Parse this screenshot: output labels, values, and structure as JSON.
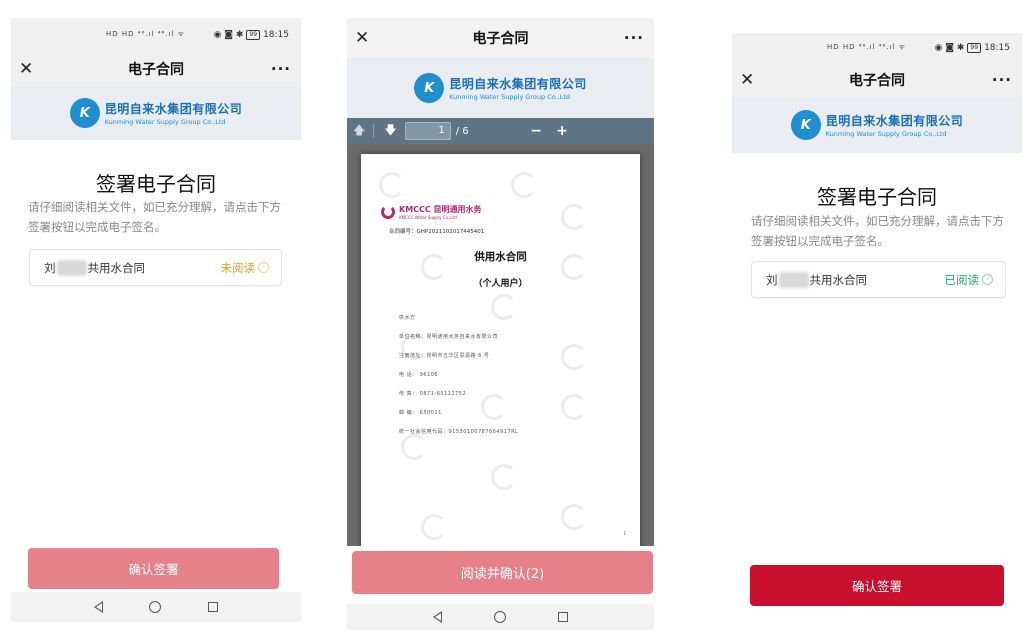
{
  "screen1": {
    "status_left": "HD HD ⁴⁶.ıl ⁴⁶.ıl ᯤ",
    "status_right": "◉ ◙ ✱",
    "battery": "99",
    "time": "18:15",
    "nav_close": "✕",
    "nav_title": "电子合同",
    "nav_more": "···",
    "logo_cn": "昆明自来水集团有限公司",
    "logo_en": "Kunming Water Supply Group Co.,Ltd",
    "sign_title": "签署电子合同",
    "sign_desc": "请仔细阅读相关文件，如已充分理解，请点击下方签署按钮以完成电子签名。",
    "contract_prefix": "刘",
    "contract_suffix": "共用水合同",
    "contract_status": "未阅读",
    "confirm_label": "确认签署"
  },
  "screen2": {
    "nav_close": "✕",
    "nav_title": "电子合同",
    "nav_more": "···",
    "logo_cn": "昆明自来水集团有限公司",
    "logo_en": "Kunming Water Supply Group Co.,Ltd",
    "toolbar": {
      "up_icon": "🡅",
      "down_icon": "🡇",
      "page": "1",
      "total": "/ 6",
      "minus": "−",
      "plus": "+"
    },
    "pdf": {
      "brand": "KMCCC 昆明通用水务",
      "brand_sub": "KMCCC Water Supply Co.,Ltd",
      "contract_no": "合同编号：GHP20211020174454​01",
      "title": "供用水合同",
      "subtitle": "（个人用户）",
      "lines": [
        "供水方",
        "单位名称：昆明通用水务自来水有限公司",
        "注册地址：昆明市五华区思源路 6 号",
        "电    话：  96106",
        "传    真：  0871-65112752",
        "邮    编：  650011",
        "统一社会信用代码：91530100787664917RL"
      ],
      "page_number": "1"
    },
    "confirm_label": "阅读并确认(2)"
  },
  "screen3": {
    "status_left": "HD HD ⁴⁶.ıl ⁴⁶.ıl ᯤ",
    "status_right": "◉ ◙ ✱",
    "battery": "99",
    "time": "18:15",
    "nav_close": "✕",
    "nav_title": "电子合同",
    "nav_more": "···",
    "logo_cn": "昆明自来水集团有限公司",
    "logo_en": "Kunming Water Supply Group Co.,Ltd",
    "sign_title": "签署电子合同",
    "sign_desc": "请仔细阅读相关文件，如已充分理解，请点击下方签署按钮以完成电子签名。",
    "contract_prefix": "刘",
    "contract_suffix": "共用水合同",
    "contract_status": "已阅读",
    "confirm_label": "确认签署"
  },
  "colors": {
    "unread": "#d9a230",
    "read": "#2ba86b",
    "button_disabled": "#e6818a",
    "button_active": "#c8102e",
    "brand_blue": "#1a6fb6",
    "pdf_toolbar": "#5f7484"
  }
}
